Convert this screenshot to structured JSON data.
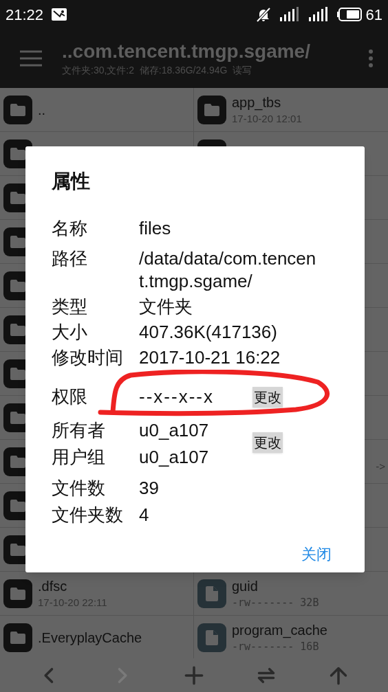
{
  "status_bar": {
    "time": "21:22",
    "battery": "61"
  },
  "app_bar": {
    "title": "..com.tencent.tmgp.sgame/",
    "subtitle": "文件夹:30,文件:2  储存:18.36G/24.94G  读写"
  },
  "left_pane": {
    "items": [
      {
        "kind": "folder",
        "name": ".."
      },
      {
        "kind": "folder"
      },
      {
        "kind": "folder"
      },
      {
        "kind": "folder"
      },
      {
        "kind": "folder"
      },
      {
        "kind": "folder"
      },
      {
        "kind": "folder"
      },
      {
        "kind": "folder"
      },
      {
        "kind": "folder"
      },
      {
        "kind": "folder"
      },
      {
        "kind": "folder"
      },
      {
        "kind": "folder",
        "name": ".dfsc",
        "meta": "17-10-20 22:11"
      },
      {
        "kind": "folder",
        "name": ".EveryplayCache"
      }
    ]
  },
  "right_pane": {
    "items": [
      {
        "kind": "folder",
        "name": "app_tbs",
        "meta": "17-10-20 12:01"
      },
      {
        "kind": "folder"
      },
      {
        "kind": "blank"
      },
      {
        "kind": "blank"
      },
      {
        "kind": "blank"
      },
      {
        "kind": "blank"
      },
      {
        "kind": "blank"
      },
      {
        "kind": "blank"
      },
      {
        "kind": "blank",
        "meta": "->"
      },
      {
        "kind": "blank"
      },
      {
        "kind": "blank"
      },
      {
        "kind": "file",
        "name": "guid",
        "meta": "-rw-------  32B"
      },
      {
        "kind": "file",
        "name": "program_cache",
        "meta": "-rw-------  16B"
      }
    ]
  },
  "dialog": {
    "title": "属性",
    "fields": [
      {
        "label": "名称",
        "value": "files"
      },
      {
        "label": "路径",
        "value": "/data/data/com.tencent.tmgp.sgame/"
      },
      {
        "label": "类型",
        "value": "文件夹"
      },
      {
        "label": "大小",
        "value": "407.36K(417136)"
      },
      {
        "label": "修改时间",
        "value": "2017-10-21 16:22"
      }
    ],
    "permission": {
      "label": "权限",
      "value": "--x--x--x",
      "action": "更改"
    },
    "ownership": {
      "rows": [
        {
          "label": "所有者",
          "value": "u0_a107"
        },
        {
          "label": "用户组",
          "value": "u0_a107"
        }
      ],
      "action": "更改"
    },
    "counts": [
      {
        "label": "文件数",
        "value": "39"
      },
      {
        "label": "文件夹数",
        "value": "4"
      }
    ],
    "close_button": "关闭"
  },
  "toolbar": [
    {
      "kind": "back",
      "disabled": false
    },
    {
      "kind": "forward",
      "disabled": true
    },
    {
      "kind": "add",
      "disabled": false
    },
    {
      "kind": "swap",
      "disabled": false
    },
    {
      "kind": "up",
      "disabled": false
    }
  ]
}
